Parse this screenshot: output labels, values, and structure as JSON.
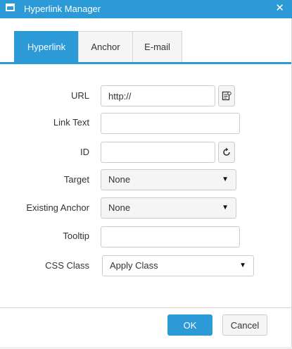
{
  "window": {
    "title": "Hyperlink Manager",
    "close_glyph": "✕"
  },
  "tabs": [
    {
      "label": "Hyperlink",
      "active": true
    },
    {
      "label": "Anchor",
      "active": false
    },
    {
      "label": "E-mail",
      "active": false
    }
  ],
  "form": {
    "url": {
      "label": "URL",
      "value": "http://"
    },
    "link_text": {
      "label": "Link Text",
      "value": ""
    },
    "id": {
      "label": "ID",
      "value": ""
    },
    "target": {
      "label": "Target",
      "selected": "None"
    },
    "existing_anchor": {
      "label": "Existing Anchor",
      "selected": "None"
    },
    "tooltip": {
      "label": "Tooltip",
      "value": ""
    },
    "css_class": {
      "label": "CSS Class",
      "selected": "Apply Class"
    }
  },
  "buttons": {
    "ok": "OK",
    "cancel": "Cancel"
  },
  "icons": {
    "window": "window-icon",
    "browse": "document-browser-icon",
    "regenerate": "refresh-icon",
    "dropdown": "dropdown-caret-icon"
  },
  "colors": {
    "accent": "#2b9ad6",
    "border": "#cccccc",
    "field_bg": "#f5f5f5"
  }
}
